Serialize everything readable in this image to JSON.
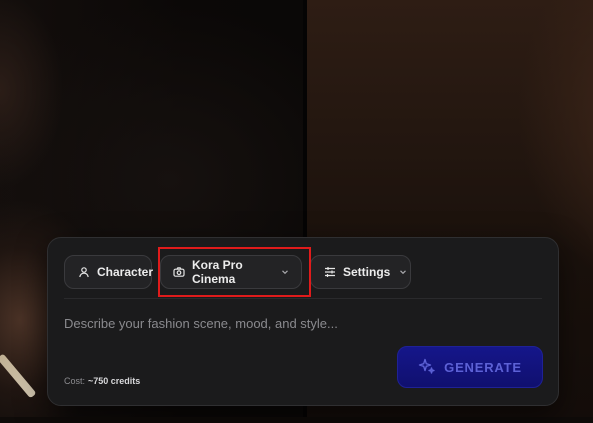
{
  "composer": {
    "character_button": {
      "label": "Character",
      "icon": "user-icon"
    },
    "camera_button": {
      "label": "Kora Pro Cinema",
      "icon": "camera-icon"
    },
    "settings_button": {
      "label": "Settings",
      "icon": "sliders-icon"
    },
    "prompt": {
      "value": "",
      "placeholder": "Describe your fashion scene, mood, and style..."
    },
    "cost": {
      "label": "Cost:",
      "value": "~750 credits"
    },
    "generate_button": {
      "label": "GENERATE",
      "icon": "sparkle-icon"
    }
  },
  "colors": {
    "panel": "#1b1b1c",
    "chip": "#232325",
    "generate_bg": "#14157f",
    "generate_text": "#5c61d6",
    "highlight": "#e01b1b"
  }
}
